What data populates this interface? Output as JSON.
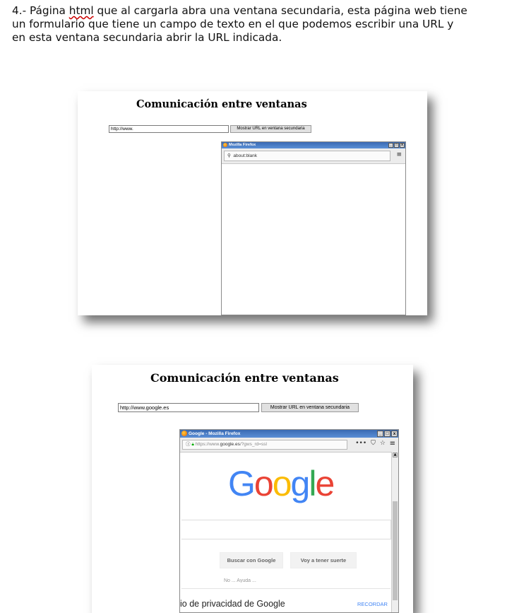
{
  "intro": {
    "line1_prefix": "4.- Página ",
    "line1_misspelled": "html",
    "line1_suffix": " que al cargarla abra una ventana secundaria, esta página web tiene",
    "line2": "un formulario que tiene un campo de texto en el que podemos escribir una URL y",
    "line3": "en esta ventana secundaria abrir la URL indicada."
  },
  "screenshot1": {
    "page_title": "Comunicación entre ventanas",
    "url_input_value": "http://www.",
    "show_button_label": "Mostrar URL en ventana secundaria",
    "popup": {
      "title": "Mozilla Firefox",
      "address": "about:blank",
      "icons": [
        "firefox-icon",
        "search-icon",
        "menu-icon"
      ]
    }
  },
  "screenshot2": {
    "page_title": "Comunicación entre ventanas",
    "url_input_value": "http://www.google.es",
    "show_button_label": "Mostrar URL en ventana secundaria",
    "popup": {
      "title": "Google - Mozilla Firefox",
      "address_prefix": "https://www.",
      "address_domain": "google.es",
      "address_suffix": "/?gws_rd=ssl",
      "toolbar_more": "•••",
      "icons": [
        "info-icon",
        "lock-icon",
        "pocket-icon",
        "star-icon",
        "menu-icon"
      ],
      "google": {
        "logo_text": "Google",
        "logo_colors": [
          "#4285F4",
          "#EA4335",
          "#FBBC05",
          "#4285F4",
          "#34A853",
          "#EA4335"
        ],
        "search_button": "Buscar con Google",
        "lucky_button": "Voy a tener suerte",
        "faded_line": "No ... Ayuda ... ",
        "privacy_text": "io de privacidad de Google",
        "remind_label": "RECORDAR"
      }
    }
  }
}
